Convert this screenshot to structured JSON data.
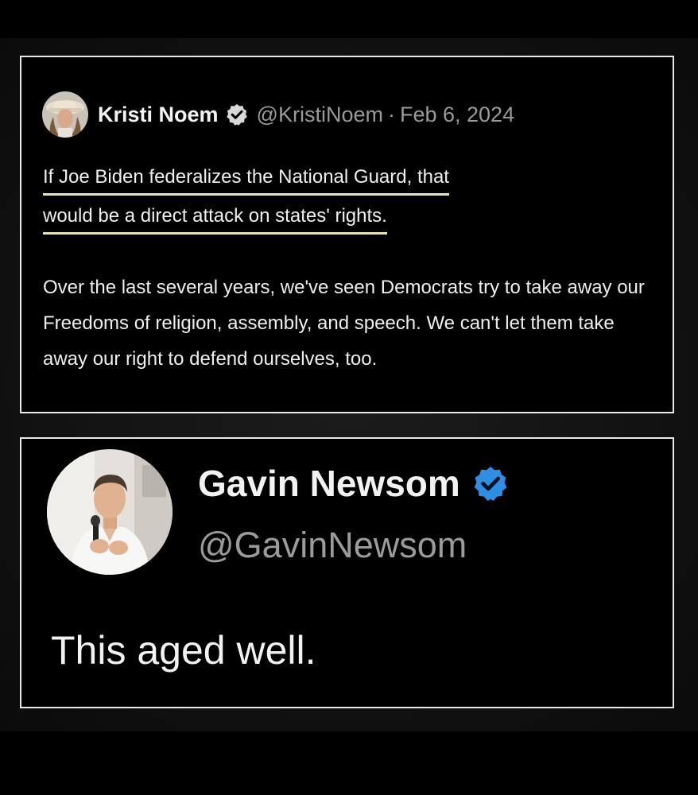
{
  "tweet1": {
    "name": "Kristi Noem",
    "handle": "@KristiNoem",
    "separator": "·",
    "date": "Feb 6, 2024",
    "highlight_line1": "If Joe Biden federalizes the National Guard, that",
    "highlight_line2": "would be a direct attack on states' rights.",
    "paragraph2": "Over the last several years, we've seen Democrats try to take away our Freedoms of religion, assembly, and speech. We can't let them take away our right to defend ourselves, too.",
    "avatar_icon": "kristi-noem-profile-photo",
    "badge_icon": "verified-badge-icon",
    "badge_color": "#d8d8d8"
  },
  "tweet2": {
    "name": "Gavin Newsom",
    "handle": "@GavinNewsom",
    "text": "This aged well.",
    "avatar_icon": "gavin-newsom-profile-photo",
    "badge_icon": "verified-badge-icon",
    "badge_color": "#2f8de4"
  },
  "colors": {
    "background": "#000000",
    "card_border": "#e9e9e9",
    "primary_text": "#f2f2f2",
    "secondary_text": "#9a9a9a",
    "highlight_underline": "#e8e2b8",
    "verified_blue": "#2f8de4"
  }
}
